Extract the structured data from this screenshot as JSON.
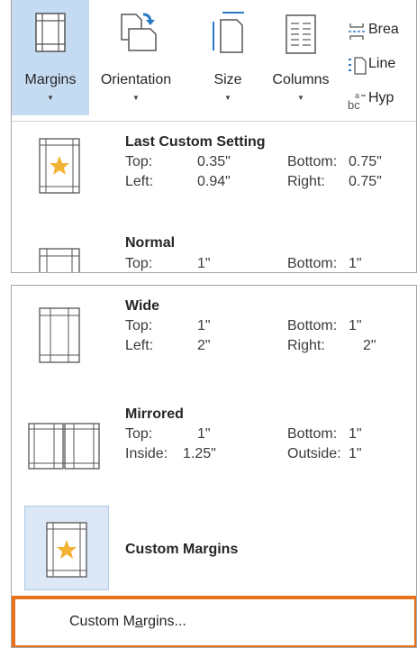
{
  "ribbon": {
    "buttons": [
      {
        "label": "Margins",
        "icon": "margins-icon",
        "active": true
      },
      {
        "label": "Orientation",
        "icon": "orientation-icon"
      },
      {
        "label": "Size",
        "icon": "size-icon"
      },
      {
        "label": "Columns",
        "icon": "columns-icon"
      }
    ],
    "small_buttons": [
      {
        "label": "Brea",
        "icon": "breaks-icon"
      },
      {
        "label": "Line",
        "icon": "line-numbers-icon"
      },
      {
        "label": "Hyp",
        "icon": "hyphenation-icon",
        "icon_text": "bc"
      }
    ],
    "caret": "▼"
  },
  "margin_presets": [
    {
      "name": "Last Custom Setting",
      "labels": [
        "Top:",
        "Bottom:",
        "Left:",
        "Right:"
      ],
      "values": [
        "0.35\"",
        "0.75\"",
        "0.94\"",
        "0.75\""
      ],
      "thumb": "star"
    },
    {
      "name": "Normal",
      "labels": [
        "Top:",
        "Bottom:"
      ],
      "values": [
        "1\"",
        "1\""
      ],
      "thumb": "normal"
    },
    {
      "name": "Wide",
      "labels": [
        "Top:",
        "Bottom:",
        "Left:",
        "Right:"
      ],
      "values": [
        "1\"",
        "1\"",
        "2\"",
        "2\""
      ],
      "thumb": "wide"
    },
    {
      "name": "Mirrored",
      "labels": [
        "Top:",
        "Bottom:",
        "Inside:",
        "Outside:"
      ],
      "values": [
        "1\"",
        "1\"",
        "1.25\"",
        "1\""
      ],
      "thumb": "mirrored"
    },
    {
      "name": "Custom Margins",
      "thumb": "star"
    }
  ],
  "footer": {
    "label_before": "Custom M",
    "label_access_key": "a",
    "label_after": "rgins..."
  },
  "colors": {
    "active": "#c5dbf1",
    "highlight_border": "#e8711c",
    "star": "#f2b233"
  }
}
